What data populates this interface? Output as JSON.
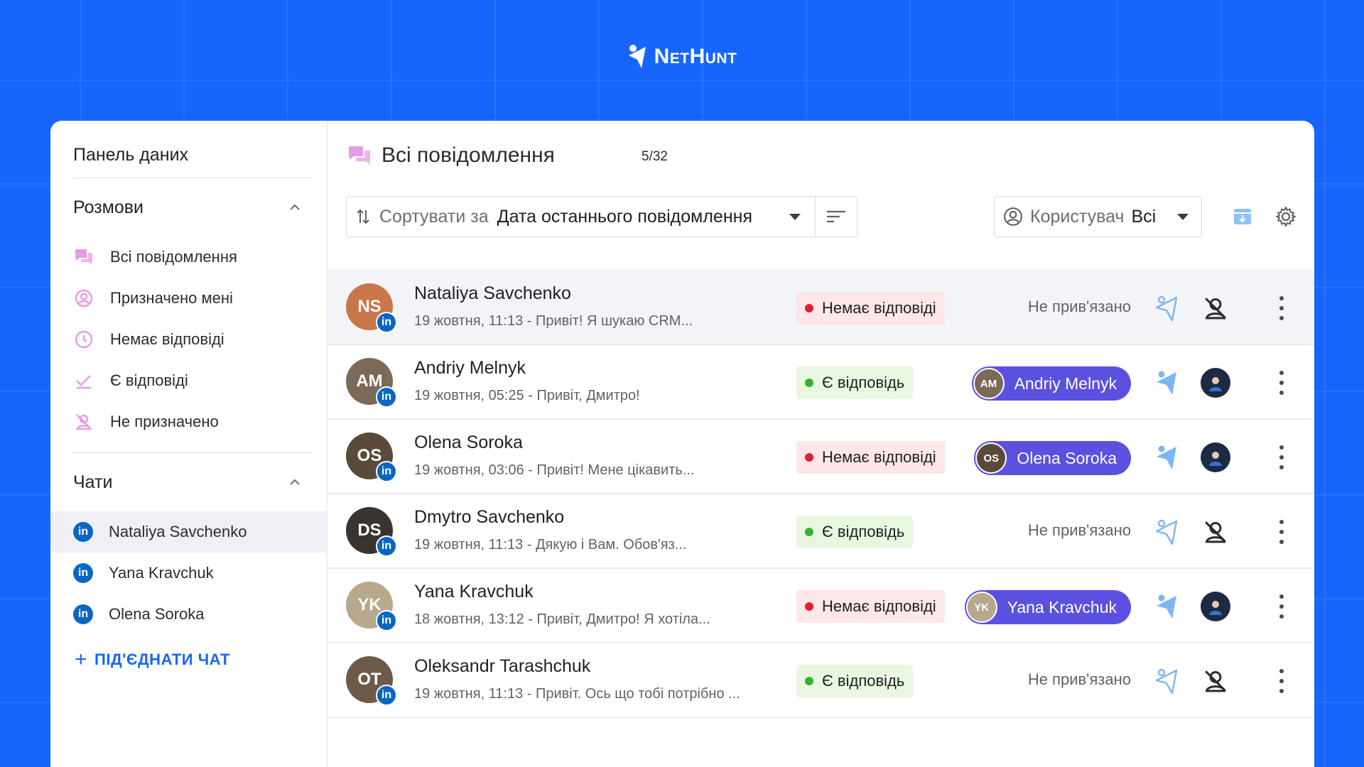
{
  "brand": {
    "name": "NetHunt"
  },
  "sidebar": {
    "title": "Панель даних",
    "conversations_label": "Розмови",
    "filters": [
      {
        "label": "Всі повідомлення",
        "icon": "chat-bubbles-icon"
      },
      {
        "label": "Призначено мені",
        "icon": "user-circle-icon"
      },
      {
        "label": "Немає відповіді",
        "icon": "clock-icon"
      },
      {
        "label": "Є відповіді",
        "icon": "check-icon"
      },
      {
        "label": "Не призначено",
        "icon": "user-off-icon"
      }
    ],
    "chats_label": "Чати",
    "chats": [
      {
        "label": "Nataliya Savchenko",
        "icon": "linkedin-icon",
        "active": true
      },
      {
        "label": "Yana Kravchuk",
        "icon": "linkedin-icon"
      },
      {
        "label": "Olena Soroka",
        "icon": "linkedin-icon"
      }
    ],
    "connect_label": "ПІД'ЄДНАТИ ЧАТ",
    "linkedin_glyph": "in"
  },
  "header": {
    "title": "Всі повідомлення",
    "count": "5/32",
    "sort_prefix": "Сортувати за",
    "sort_value": "Дата останнього повідомлення",
    "user_prefix": "Користувач",
    "user_value": "Всі"
  },
  "conversations": [
    {
      "name": "Nataliya Savchenko",
      "message": "19 жовтня, 11:13 - Привіт! Я шукаю CRM...",
      "status": "Немає відповіді",
      "status_type": "no",
      "linked": "Не прив'язано",
      "initials": "NS",
      "avatar_color": "#C9774A"
    },
    {
      "name": "Andriy Melnyk",
      "message": "19 жовтня, 05:25 - Привіт, Дмитро!",
      "status": "Є відповідь",
      "status_type": "yes",
      "assignee": "Andriy Melnyk",
      "initials": "AM",
      "avatar_color": "#7B6A58"
    },
    {
      "name": "Olena Soroka",
      "message": "19 жовтня, 03:06 - Привіт! Мене цікавить...",
      "status": "Немає відповіді",
      "status_type": "no",
      "assignee": "Olena Soroka",
      "initials": "OS",
      "avatar_color": "#5B4A3A"
    },
    {
      "name": "Dmytro Savchenko",
      "message": "19 жовтня, 11:13 - Дякую і Вам. Обов'яз...",
      "status": "Є відповідь",
      "status_type": "yes",
      "linked": "Не прив'язано",
      "initials": "DS",
      "avatar_color": "#3A3430"
    },
    {
      "name": "Yana Kravchuk",
      "message": "18 жовтня, 13:12 - Привіт, Дмитро! Я хотіла...",
      "status": "Немає відповіді",
      "status_type": "no",
      "assignee": "Yana Kravchuk",
      "initials": "YK",
      "avatar_color": "#B8A88C"
    },
    {
      "name": "Oleksandr Tarashchuk",
      "message": "19 жовтня, 11:13 - Привіт. Ось що тобі потрібно ...",
      "status": "Є відповідь",
      "status_type": "yes",
      "linked": "Не прив'язано",
      "initials": "OT",
      "avatar_color": "#6E5A48"
    }
  ],
  "colors": {
    "background": "#1766FB",
    "accent_pink": "#E89BE4",
    "linkedin": "#0A66C2",
    "assignee_pill": "#5B51E0",
    "status_no_bg": "#FDE7E8",
    "status_no_dot": "#E5202B",
    "status_yes_bg": "#E9F7E1",
    "status_yes_dot": "#33B32E"
  }
}
